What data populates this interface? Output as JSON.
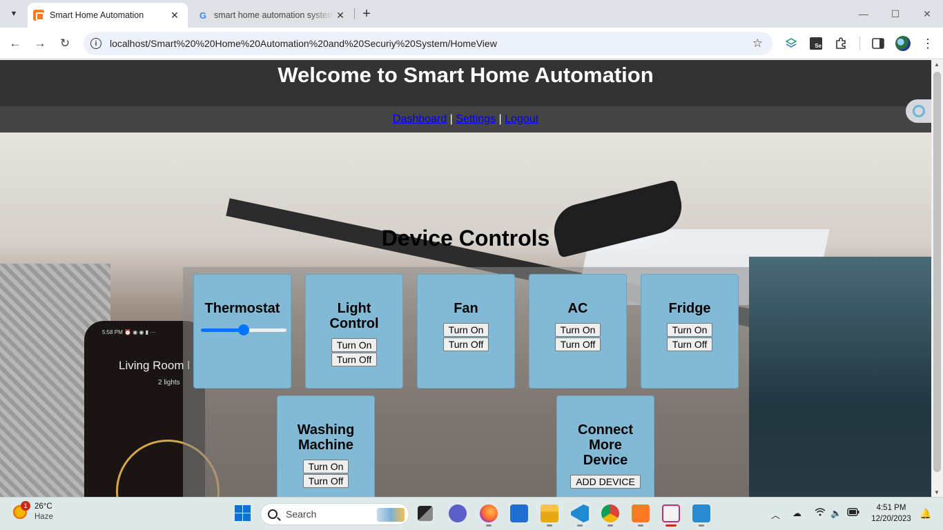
{
  "browser": {
    "tabs": [
      {
        "title": "Smart Home Automation",
        "active": true,
        "icon": "xampp-icon"
      },
      {
        "title": "smart home automation system",
        "active": false,
        "icon": "google-icon"
      }
    ],
    "url": "localhost/Smart%20%20Home%20Automation%20and%20Securiy%20System/HomeView",
    "controls": {
      "minimize": "—",
      "maximize": "☐",
      "close": "✕"
    }
  },
  "page": {
    "header_title": "Welcome to Smart Home Automation",
    "nav": {
      "dashboard": "Dashboard",
      "separator": "|",
      "settings": "Settings",
      "logout": "Logout"
    },
    "section_title": "Device Controls",
    "background_text": {
      "phone_time": "5:58 PM ⏰ ◉ ◉ ▮ ···",
      "phone_room": "Living Room l",
      "phone_lights": "2 lights"
    },
    "devices": {
      "thermostat": {
        "title": "Thermostat",
        "slider_value": 0.5
      },
      "light": {
        "title": "Light Control",
        "on": "Turn On",
        "off": "Turn Off"
      },
      "fan": {
        "title": "Fan",
        "on": "Turn On",
        "off": "Turn Off"
      },
      "ac": {
        "title": "AC",
        "on": "Turn On",
        "off": "Turn Off"
      },
      "fridge": {
        "title": "Fridge",
        "on": "Turn On",
        "off": "Turn Off"
      },
      "washing": {
        "title": "Washing Machine",
        "on": "Turn On",
        "off": "Turn Off"
      },
      "connect": {
        "title": "Connect More Device",
        "button": "ADD DEVICE"
      }
    }
  },
  "taskbar": {
    "weather": {
      "temp": "26°C",
      "condition": "Haze",
      "badge": "1"
    },
    "search_label": "Search",
    "time": "4:51 PM",
    "date": "12/20/2023"
  },
  "colors": {
    "header_bg": "#333333",
    "nav_bg": "#444444",
    "card_bg": "#82bad6",
    "link": "#0000ee",
    "slider_accent": "#0075ff"
  }
}
